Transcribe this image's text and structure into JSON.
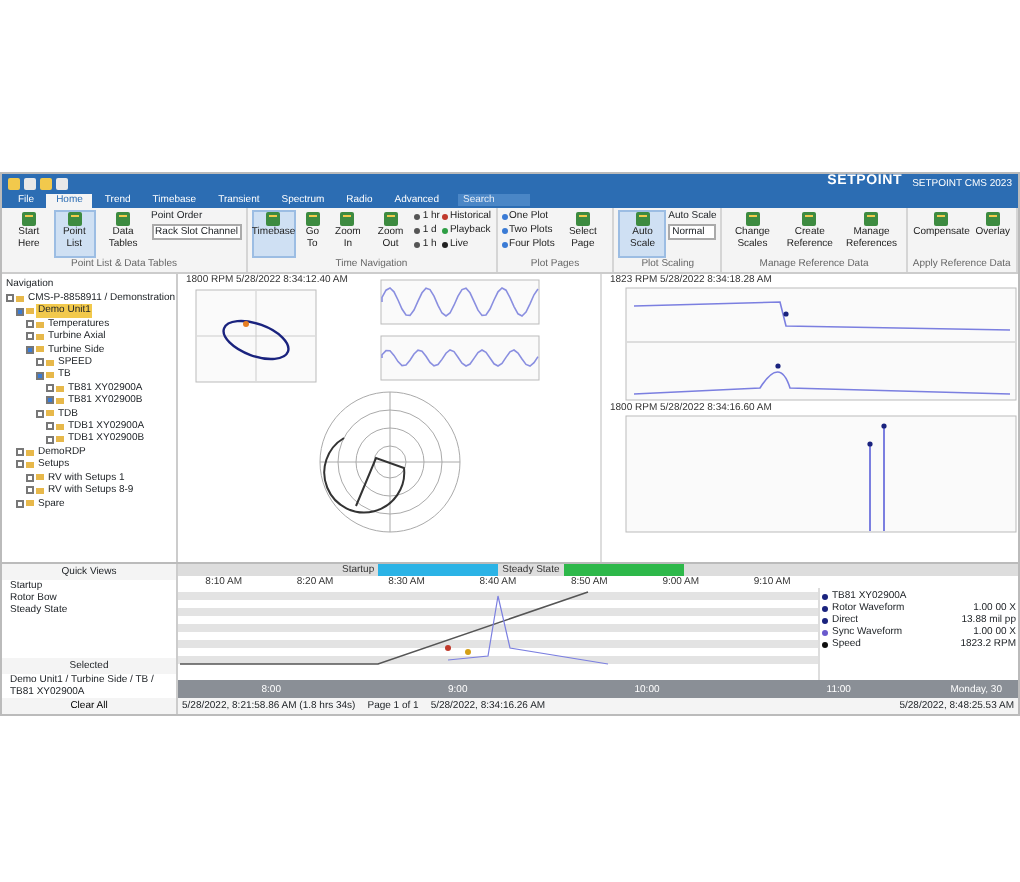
{
  "title_bar": {
    "logo": "SETPOINT",
    "subtitle": "SETPOINT CMS 2023"
  },
  "tabs": [
    {
      "label": "File",
      "selected": false
    },
    {
      "label": "Home",
      "selected": true
    },
    {
      "label": "Trend",
      "selected": false
    },
    {
      "label": "Timebase",
      "selected": false
    },
    {
      "label": "Transient",
      "selected": false
    },
    {
      "label": "Spectrum",
      "selected": false
    },
    {
      "label": "Radio",
      "selected": false
    },
    {
      "label": "Advanced",
      "selected": false
    }
  ],
  "search": {
    "placeholder": "Search"
  },
  "ribbon_groups": [
    {
      "caption": "Point List & Data Tables",
      "items": [
        {
          "kind": "big",
          "label": "Start Here",
          "selected": false
        },
        {
          "kind": "big",
          "label": "Point List",
          "selected": true
        },
        {
          "kind": "big",
          "label": "Data Tables",
          "selected": false
        },
        {
          "kind": "combo",
          "label": "Point Order",
          "value": "Rack Slot Channel"
        }
      ]
    },
    {
      "caption": "Time Navigation",
      "items": [
        {
          "kind": "big",
          "label": "Timebase",
          "selected": true
        },
        {
          "kind": "big",
          "label": "Go To",
          "selected": false
        },
        {
          "kind": "big",
          "label": "Zoom In",
          "selected": false
        },
        {
          "kind": "big",
          "label": "Zoom Out",
          "selected": false
        },
        {
          "kind": "stack",
          "entries": [
            {
              "label": "1 hr",
              "color": "#555555"
            },
            {
              "label": "1 d",
              "color": "#555555"
            },
            {
              "label": "1 h",
              "color": "#555555"
            }
          ]
        },
        {
          "kind": "stack",
          "entries": [
            {
              "label": "Historical",
              "color": "#c0392b"
            },
            {
              "label": "Playback",
              "color": "#2e9e44"
            },
            {
              "label": "Live",
              "color": "#222222"
            }
          ]
        }
      ]
    },
    {
      "caption": "Plot Pages",
      "items": [
        {
          "kind": "stack",
          "entries": [
            {
              "label": "One Plot",
              "color": "#3a7bd5"
            },
            {
              "label": "Two Plots",
              "color": "#3a7bd5"
            },
            {
              "label": "Four Plots",
              "color": "#3a7bd5"
            }
          ]
        },
        {
          "kind": "big",
          "label": "Select Page",
          "selected": false
        }
      ]
    },
    {
      "caption": "Plot Scaling",
      "items": [
        {
          "kind": "big",
          "label": "Auto Scale",
          "selected": true
        },
        {
          "kind": "combo",
          "label": "Auto Scale",
          "value": "Normal"
        }
      ]
    },
    {
      "caption": "Manage Reference Data",
      "items": [
        {
          "kind": "big",
          "label": "Change Scales",
          "selected": false
        },
        {
          "kind": "big",
          "label": "Create Reference",
          "selected": false
        },
        {
          "kind": "big",
          "label": "Manage References",
          "selected": false
        }
      ]
    },
    {
      "caption": "Apply Reference Data",
      "items": [
        {
          "kind": "big",
          "label": "Compensate",
          "selected": false
        },
        {
          "kind": "big",
          "label": "Overlay",
          "selected": false
        }
      ]
    }
  ],
  "navigation": {
    "title": "Navigation",
    "tree": [
      {
        "label": "CMS-P-8858911 / Demonstration",
        "checked": false,
        "selected": false,
        "children": [
          {
            "label": "Demo Unit1",
            "checked": true,
            "selected": true,
            "children": [
              {
                "label": "Temperatures",
                "checked": false,
                "selected": false
              },
              {
                "label": "Turbine Axial",
                "checked": false,
                "selected": false
              },
              {
                "label": "Turbine Side",
                "checked": true,
                "selected": false,
                "children": [
                  {
                    "label": "SPEED",
                    "checked": false,
                    "selected": false
                  },
                  {
                    "label": "TB",
                    "checked": true,
                    "selected": false,
                    "children": [
                      {
                        "label": "TB81 XY02900A",
                        "checked": false,
                        "selected": false
                      },
                      {
                        "label": "TB81 XY02900B",
                        "checked": true,
                        "selected": false
                      }
                    ]
                  },
                  {
                    "label": "TDB",
                    "checked": false,
                    "selected": false,
                    "children": [
                      {
                        "label": "TDB1 XY02900A",
                        "checked": false,
                        "selected": false
                      },
                      {
                        "label": "TDB1 XY02900B",
                        "checked": false,
                        "selected": false
                      }
                    ]
                  }
                ]
              }
            ]
          },
          {
            "label": "DemoRDP",
            "checked": false,
            "selected": false
          },
          {
            "label": "Setups",
            "checked": false,
            "selected": false,
            "children": [
              {
                "label": "RV with Setups 1",
                "checked": false,
                "selected": false
              },
              {
                "label": "RV with Setups 8-9",
                "checked": false,
                "selected": false
              }
            ]
          },
          {
            "label": "Spare",
            "checked": false,
            "selected": false
          }
        ]
      }
    ]
  },
  "plots": [
    {
      "kind": "orbit",
      "header": [
        "1800 RPM 5/28/2022 8:34:12.40 AM"
      ]
    },
    {
      "kind": "waveform"
    },
    {
      "kind": "polar"
    },
    {
      "kind": "bode",
      "header": [
        "1823 RPM 5/28/2022 8:34:18.28 AM"
      ]
    },
    {
      "kind": "spectrum",
      "header": [
        "1800 RPM 5/28/2022 8:34:16.60 AM"
      ]
    }
  ],
  "quick_views": {
    "title": "Quick Views",
    "items": [
      "Startup",
      "Rotor Bow",
      "Steady State"
    ]
  },
  "selected_panel": {
    "title": "Selected",
    "path": "Demo Unit1 / Turbine Side / TB / TB81 XY02900A"
  },
  "clear_all": "Clear All",
  "states": [
    {
      "label": "Startup",
      "color": "#2bb3e6"
    },
    {
      "label": "Steady State",
      "color": "#2eb84a"
    }
  ],
  "time_ticks": [
    "8:10 AM",
    "8:20 AM",
    "8:30 AM",
    "8:40 AM",
    "8:50 AM",
    "9:00 AM",
    "9:10 AM"
  ],
  "trend_legend": [
    {
      "label": "TB81 XY02900A",
      "color": "#1a237e"
    },
    {
      "label": "Rotor Waveform",
      "value": "1.00 00 X",
      "color": "#1a237e"
    },
    {
      "label": "Direct",
      "value": "13.88 mil pp",
      "color": "#1a237e"
    },
    {
      "label": "Sync Waveform",
      "value": "1.00 00 X",
      "color": "#6a5acd"
    },
    {
      "label": "Speed",
      "value": "1823.2 RPM",
      "color": "#111111"
    }
  ],
  "overview": {
    "ticks": [
      "8:00",
      "9:00",
      "10:00",
      "11:00"
    ],
    "day": "Monday, 30"
  },
  "status": {
    "start": "5/28/2022, 8:21:58.86 AM (1.8 hrs 34s)",
    "page": "Page 1 of 1",
    "cursor": "5/28/2022, 8:34:16.26 AM",
    "end": "5/28/2022, 8:48:25.53 AM"
  }
}
